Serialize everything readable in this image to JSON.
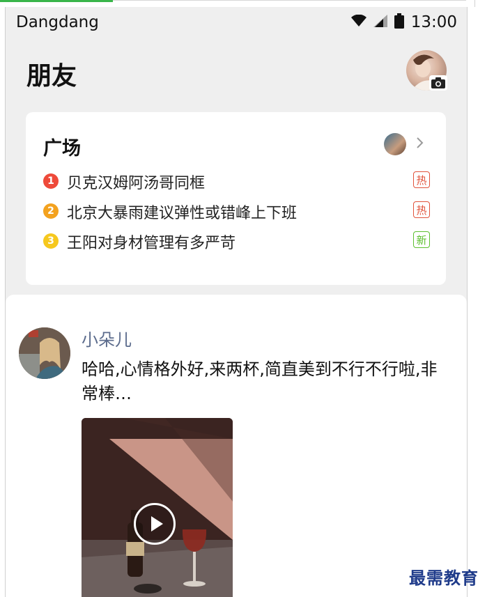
{
  "status_bar": {
    "carrier": "Dangdang",
    "time": "13:00",
    "icons": [
      "wifi-icon",
      "signal-icon",
      "battery-icon"
    ]
  },
  "header": {
    "title": "朋友",
    "avatar_icon": "camera-icon"
  },
  "square": {
    "title": "广场",
    "topics": [
      {
        "rank": "1",
        "text": "贝克汉姆阿汤哥同框",
        "tag": "热",
        "rank_color": "#ee4a3a",
        "tag_color": "#e0533b"
      },
      {
        "rank": "2",
        "text": "北京大暴雨建议弹性或错峰上下班",
        "tag": "热",
        "rank_color": "#f3a21f",
        "tag_color": "#e0533b"
      },
      {
        "rank": "3",
        "text": "王阳对身材管理有多严苛",
        "tag": "新",
        "rank_color": "#f6c81e",
        "tag_color": "#5cbf2f"
      }
    ]
  },
  "post": {
    "author": "小朵儿",
    "text": "哈哈,心情格外好,来两杯,简直美到不行不行啦,非常棒…",
    "video_icon": "play-icon"
  },
  "watermark": "最需教育",
  "colors": {
    "accent_name": "#5b6b8c",
    "background": "#efefef",
    "card": "#ffffff"
  }
}
